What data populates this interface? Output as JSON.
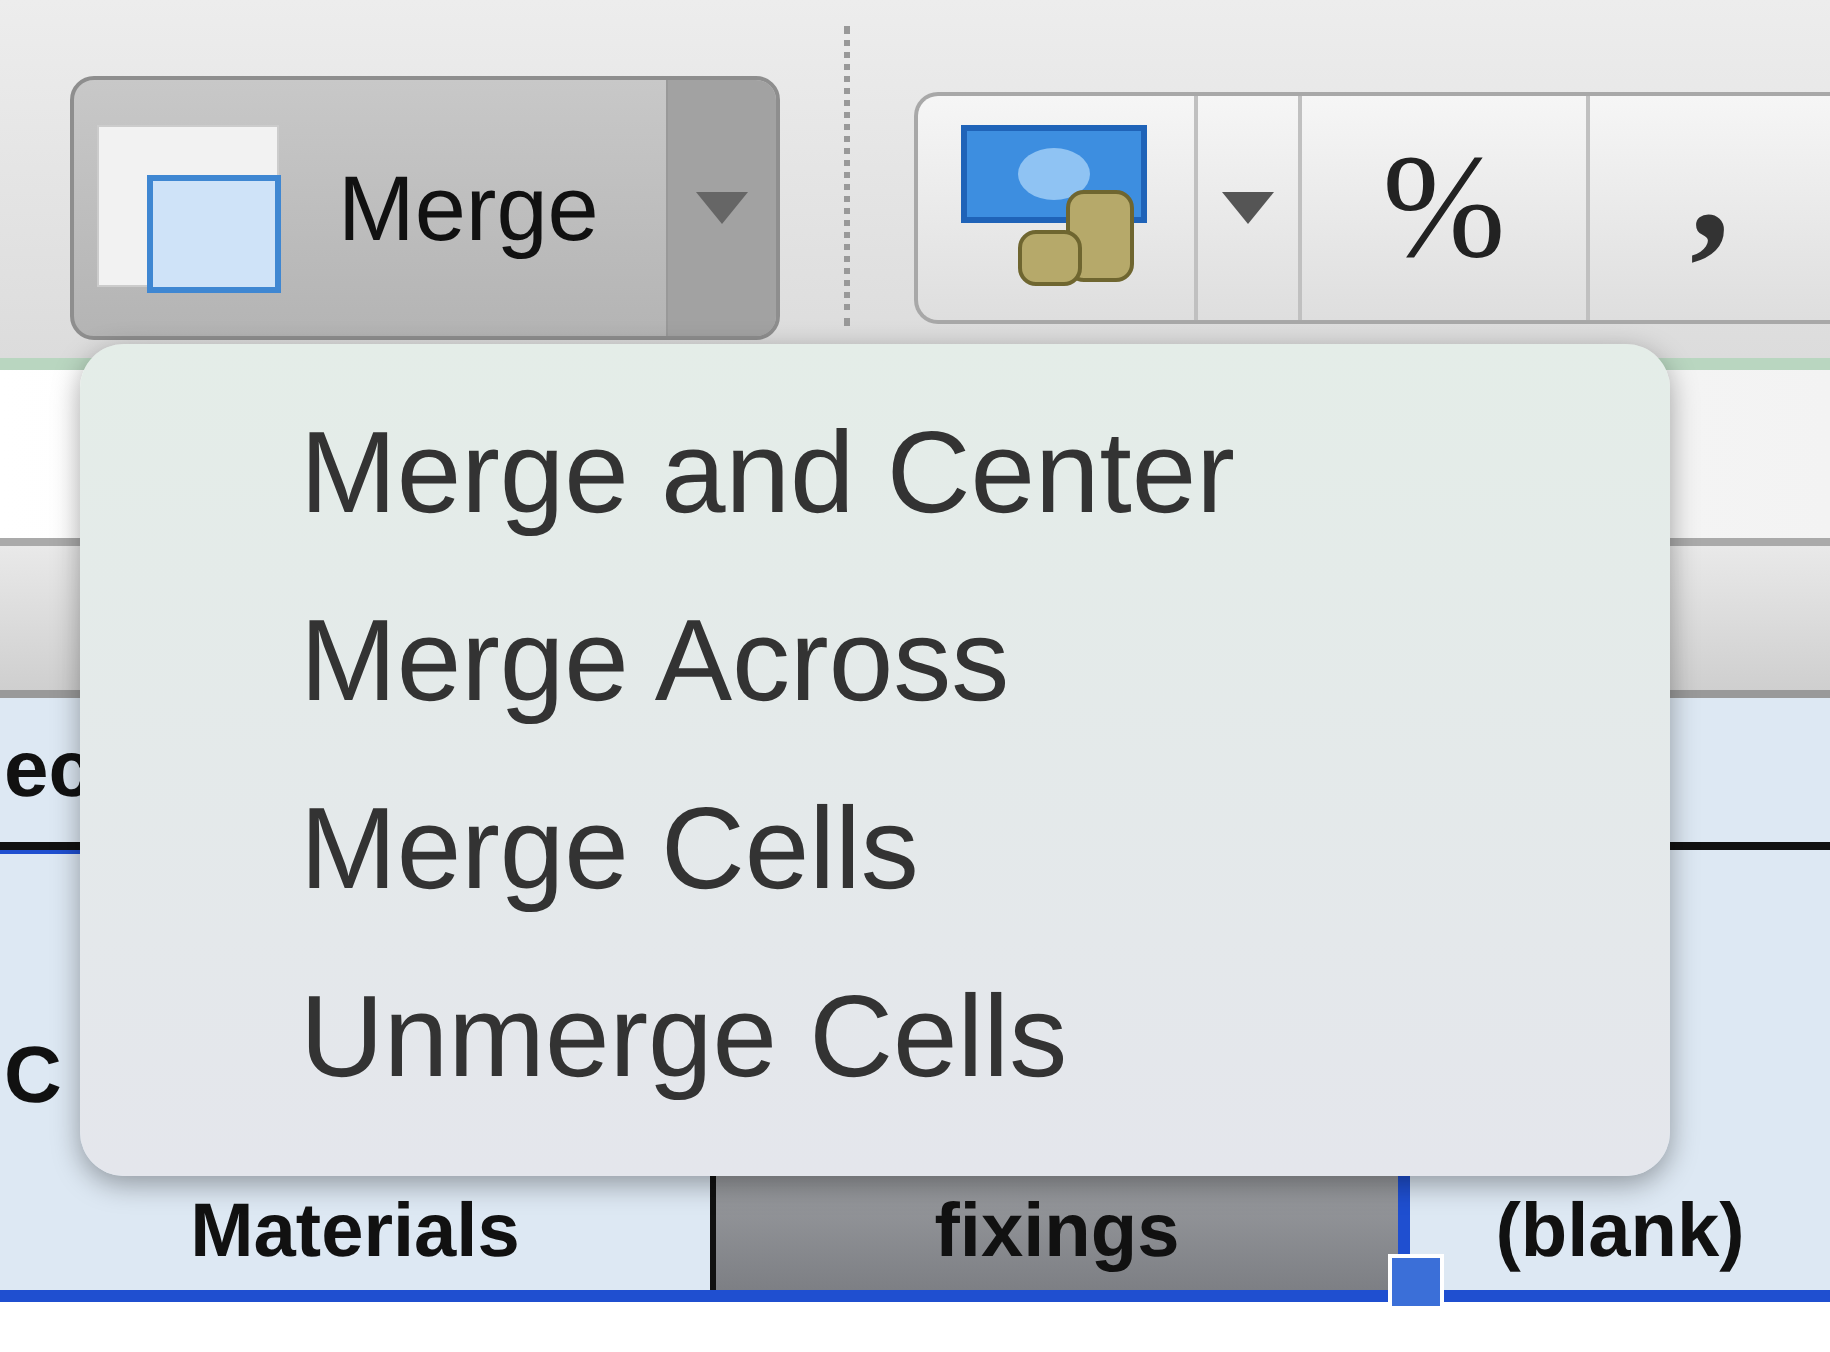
{
  "toolbar": {
    "merge_button": {
      "label": "Merge"
    },
    "percent_button": {
      "label": "%"
    },
    "comma_button": {
      "label": ","
    }
  },
  "merge_menu": {
    "items": [
      {
        "label": "Merge and Center"
      },
      {
        "label": "Merge Across"
      },
      {
        "label": "Merge Cells"
      },
      {
        "label": "Unmerge Cells"
      }
    ]
  },
  "sheet": {
    "cell_fragments": [
      "ec",
      "C"
    ],
    "header_row": [
      {
        "label": "Materials",
        "selected": false
      },
      {
        "label": "fixings",
        "selected": true
      },
      {
        "label": "(blank)",
        "selected": false
      }
    ]
  }
}
